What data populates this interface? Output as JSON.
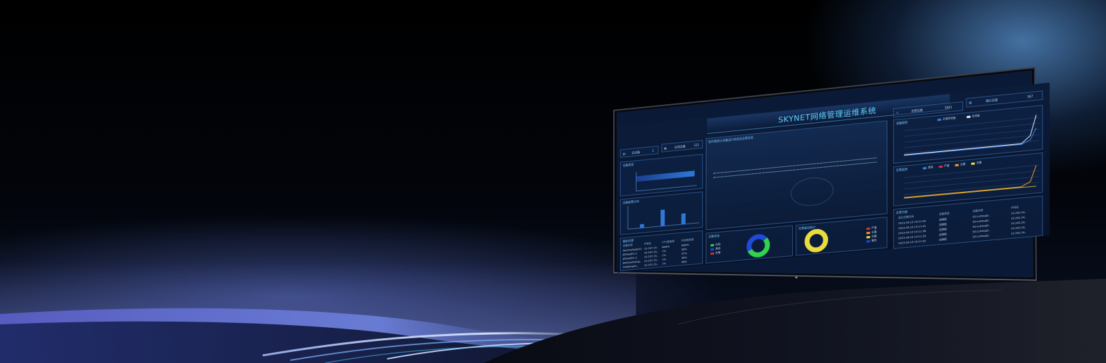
{
  "app_title": "SKYNET网络管理运维系统",
  "top_stats": {
    "left": [
      {
        "icon": "server-icon",
        "label": "总设备",
        "value": "1"
      },
      {
        "icon": "grid-icon",
        "label": "在线设备",
        "value": "121"
      }
    ],
    "right": [
      {
        "icon": "alarm-icon",
        "label": "告警总数",
        "value": "5841"
      },
      {
        "icon": "switch-icon",
        "label": "端口总量",
        "value": "567"
      }
    ]
  },
  "panels": {
    "bar_panel": "设备类型",
    "col_panel": "设备报警分布",
    "table_panel": "最新告警",
    "center_top_note": "拓扑图显示设备运行状态及告警信息",
    "donut1_panel": "设备状态",
    "donut2_panel": "告警级别统计",
    "line1_panel": "流量趋势",
    "line2_panel": "告警趋势",
    "bottom_table_panel": "告警列表"
  },
  "donut1_legend": [
    "在线",
    "离线",
    "告警"
  ],
  "donut2_legend": [
    "严重",
    "主要",
    "次要",
    "警告"
  ],
  "line1_legend": [
    "已使用流量",
    "总流量"
  ],
  "line2_legend": [
    "紧急",
    "严重",
    "主要",
    "次要"
  ],
  "left_table": {
    "headers": [
      "设备名称",
      "IP地址",
      "CPU使用率",
      "内存使用率"
    ],
    "rows": [
      [
        "SkyOneSwitch1",
        "10.237.15..",
        "NaN%",
        "NaN%"
      ],
      [
        "JiZhanJR1-2",
        "10.237.15..",
        "1%",
        "36%"
      ],
      [
        "JiZhanJR1-2",
        "10.237.15..",
        "1%",
        "37%"
      ],
      [
        "JieShouZhong..",
        "10.237.15..",
        "1%",
        "36%"
      ],
      [
        "HuiDongHu..",
        "10.237.15..",
        "1%",
        "36%"
      ]
    ]
  },
  "right_table": {
    "headers": [
      "发生告警时间",
      "设备类型",
      "设备名称",
      "IP地址"
    ],
    "rows": [
      [
        "2023-09-15 15:11:45",
        "交换机",
        "SS-LuFengD..",
        "10.242.24.."
      ],
      [
        "2023-09-15 15:11:41",
        "交换机",
        "SS-LuFengD..",
        "10.242.24.."
      ],
      [
        "2023-09-15 15:11:38",
        "交换机",
        "SS-LuFengD..",
        "10.242.24.."
      ],
      [
        "2023-09-15 15:11:33",
        "交换机",
        "SS-LuFengD..",
        "10.242.24.."
      ],
      [
        "2023-09-15 15:11:32",
        "交换机",
        "SS-LuFengD..",
        "10.242.24.."
      ]
    ]
  },
  "colors": {
    "accent": "#5fd3ff",
    "donut_green": "#33d24c",
    "donut_blue": "#1f4ad8",
    "donut_yellow": "#e9dc3c",
    "line_white": "#e6eef7",
    "line_orange": "#f0962b",
    "line_blue": "#3b7fe0"
  }
}
